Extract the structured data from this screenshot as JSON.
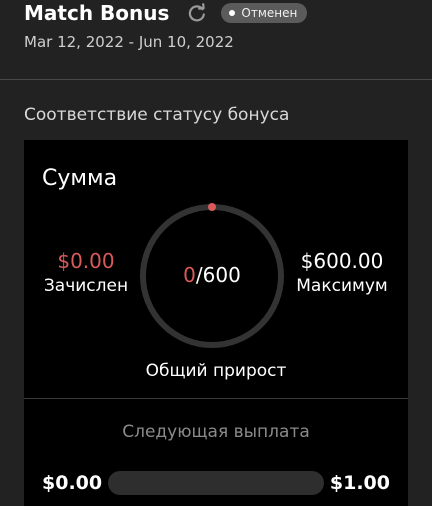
{
  "header": {
    "title": "Match Bonus",
    "status_badge": "Отменен",
    "date_range": "Mar 12, 2022 - Jun 10, 2022"
  },
  "section": {
    "title": "Соответствие статусу бонуса"
  },
  "card": {
    "heading": "Сумма",
    "credited": {
      "value": "$0.00",
      "label": "Зачислен"
    },
    "maximum": {
      "value": "$600.00",
      "label": "Максимум"
    },
    "ring": {
      "current": "0",
      "separator": "/",
      "total": "600",
      "fraction": 0
    },
    "growth_label": "Общий прирост",
    "next_payout": {
      "label": "Следующая выплата",
      "from": "$0.00",
      "to": "$1.00",
      "progress_fraction": 0
    }
  },
  "colors": {
    "accent_red": "#d95a5a",
    "background": "#222222",
    "card_background": "#000000",
    "ring_track": "#333333",
    "badge_background": "#5b5b5b"
  },
  "icons": {
    "refresh": "refresh-icon",
    "badge_dot": "status-dot-icon"
  }
}
